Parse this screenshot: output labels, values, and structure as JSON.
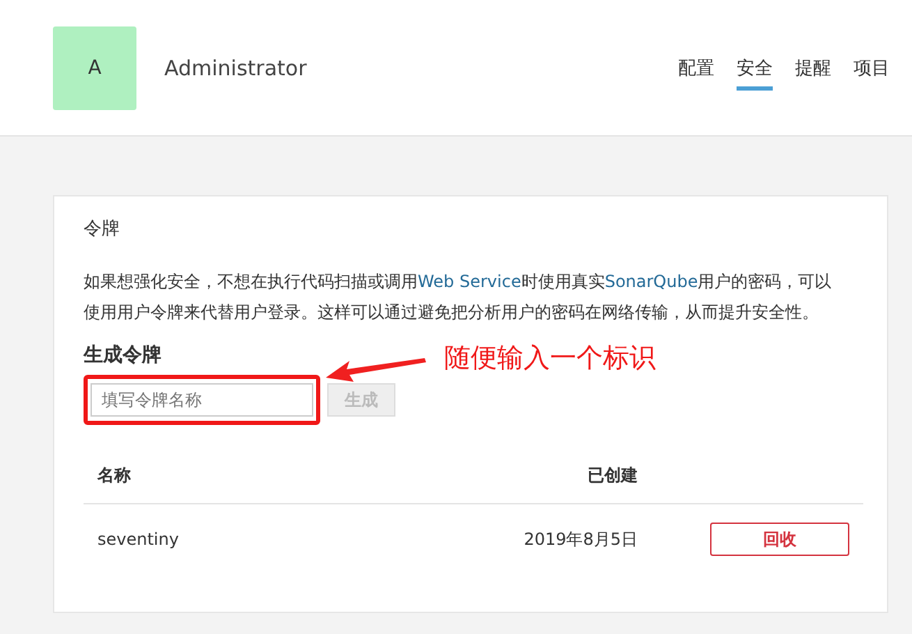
{
  "header": {
    "avatar_letter": "A",
    "user_name": "Administrator",
    "tabs": [
      {
        "label": "配置",
        "selected": false
      },
      {
        "label": "安全",
        "selected": true
      },
      {
        "label": "提醒",
        "selected": false
      },
      {
        "label": "项目",
        "selected": false
      }
    ]
  },
  "card": {
    "title": "令牌",
    "description": [
      {
        "kind": "text",
        "text": "如果想强化安全，不想在执行代码扫描或调用"
      },
      {
        "kind": "link",
        "text": "Web Service"
      },
      {
        "kind": "text",
        "text": "时使用真实"
      },
      {
        "kind": "link",
        "text": "SonarQube"
      },
      {
        "kind": "text",
        "text": "用户的密码，可以使用用户令牌来代替用户登录。这样可以通过避免把分析用户的密码在网络传输，从而提升安全性。"
      }
    ],
    "generate": {
      "heading": "生成令牌",
      "placeholder": "填写令牌名称",
      "button": {
        "label": "生成",
        "disabled": true
      }
    },
    "annotation": {
      "text": "随便输入一个标识"
    },
    "table": {
      "columns": [
        "名称",
        "已创建"
      ],
      "rows": [
        {
          "name": "seventiny",
          "created": "2019年8月5日",
          "action": "回收"
        }
      ]
    }
  }
}
